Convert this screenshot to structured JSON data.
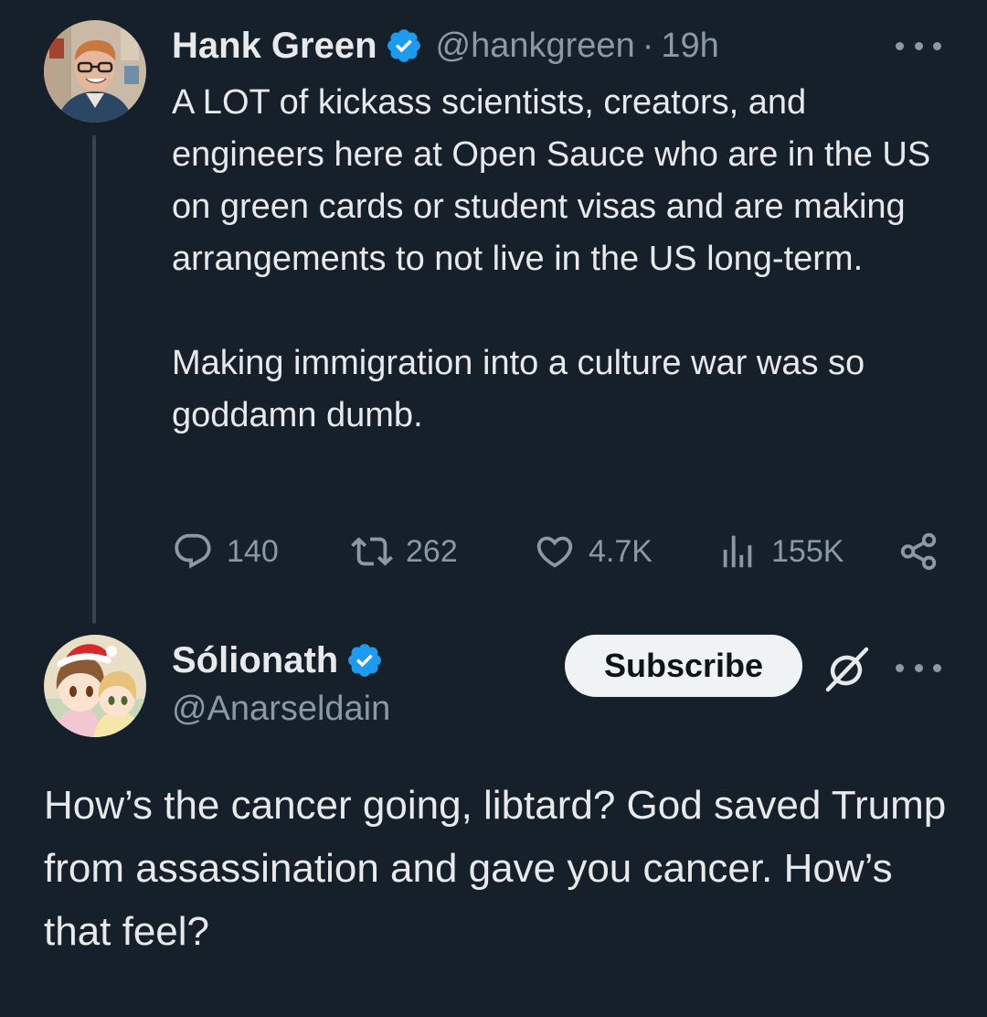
{
  "tweet": {
    "author_name": "Hank Green",
    "handle": "@hankgreen",
    "separator": "·",
    "time": "19h",
    "paragraphs": [
      "A LOT of kickass scientists, creators, and engineers here at Open Sauce who are in the US on green cards or student visas and are making arrangements to not live in the US long-term.",
      "Making immigration into a culture war was so goddamn dumb."
    ],
    "stats": {
      "replies": "140",
      "retweets": "262",
      "likes": "4.7K",
      "views": "155K"
    }
  },
  "reply": {
    "author_name": "Sólionath",
    "handle": "@Anarseldain",
    "subscribe_label": "Subscribe",
    "text": "How’s the cancer going, libtard? God saved Trump from assassination and gave you cancer. How’s that feel?"
  },
  "icons": {
    "verified": "verified-badge-icon",
    "more": "more-icon",
    "reply": "reply-icon",
    "retweet": "retweet-icon",
    "like": "heart-icon",
    "views": "views-icon",
    "share": "share-icon",
    "grok": "grok-icon"
  },
  "colors": {
    "background": "#15202b",
    "text": "#e7e9ea",
    "secondary": "#8b98a5",
    "verified": "#1d9bf0",
    "thread_line": "#38444d",
    "subscribe_bg": "#eff3f4"
  }
}
